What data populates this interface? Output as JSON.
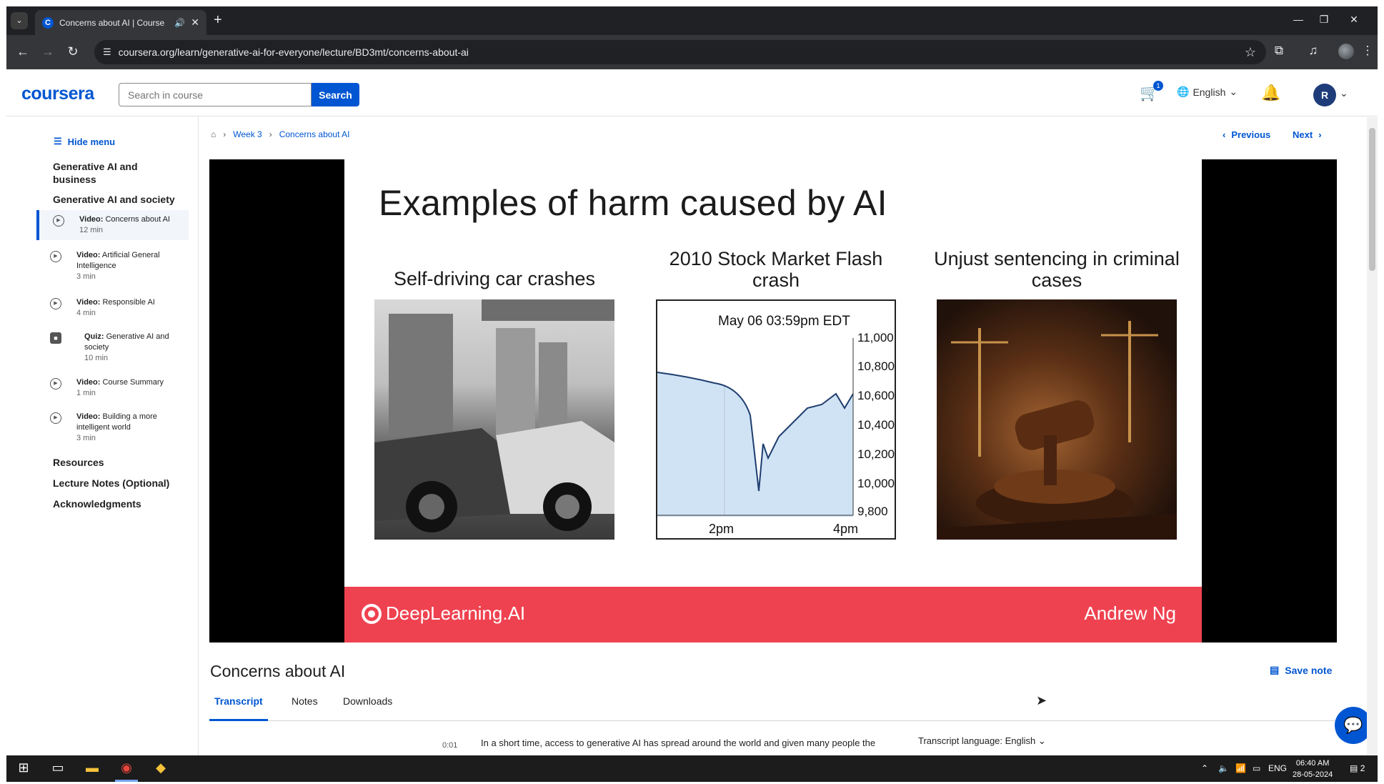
{
  "browser": {
    "tab_title": "Concerns about AI | Course",
    "url": "coursera.org/learn/generative-ai-for-everyone/lecture/BD3mt/concerns-about-ai"
  },
  "header": {
    "logo": "coursera",
    "search_placeholder": "Search in course",
    "search_label": "Search",
    "cart_count": "1",
    "language": "English",
    "avatar_initial": "R"
  },
  "sidebar": {
    "hide_menu": "Hide menu",
    "modules": [
      "Generative AI and business",
      "Generative AI and society"
    ],
    "items": [
      {
        "kind": "Video:",
        "title": "Concerns about AI",
        "duration": "12 min"
      },
      {
        "kind": "Video:",
        "title": "Artificial General Intelligence",
        "duration": "3 min"
      },
      {
        "kind": "Video:",
        "title": "Responsible AI",
        "duration": "4 min"
      },
      {
        "kind": "Quiz:",
        "title": "Generative AI and society",
        "duration": "10 min"
      },
      {
        "kind": "Video:",
        "title": "Course Summary",
        "duration": "1 min"
      },
      {
        "kind": "Video:",
        "title": "Building a more intelligent world",
        "duration": "3 min"
      }
    ],
    "links": [
      "Resources",
      "Lecture Notes (Optional)",
      "Acknowledgments"
    ]
  },
  "breadcrumb": [
    "Week 3",
    "Concerns about AI"
  ],
  "nav": {
    "previous": "Previous",
    "next": "Next"
  },
  "slide": {
    "title": "Examples of harm caused by AI",
    "col1": "Self-driving car crashes",
    "col2": "2010 Stock Market Flash crash",
    "col3": "Unjust sentencing in criminal cases",
    "chart_title": "May 06 03:59pm EDT",
    "y_ticks": [
      "11,000",
      "10,800",
      "10,600",
      "10,400",
      "10,200",
      "10,000",
      "9,800"
    ],
    "x_ticks": [
      "2pm",
      "4pm"
    ],
    "brand": "DeepLearning.AI",
    "presenter": "Andrew Ng"
  },
  "lecture": {
    "title": "Concerns about AI",
    "save_note": "Save note",
    "tabs": [
      "Transcript",
      "Notes",
      "Downloads"
    ],
    "transcript_time": "0:01",
    "transcript_text": "In a short time, access to generative AI has spread around the world and given many people the",
    "transcript_language": "Transcript language: English"
  },
  "taskbar": {
    "lang": "ENG",
    "time": "06:40 AM",
    "date": "28-05-2024",
    "notif_count": "2"
  }
}
